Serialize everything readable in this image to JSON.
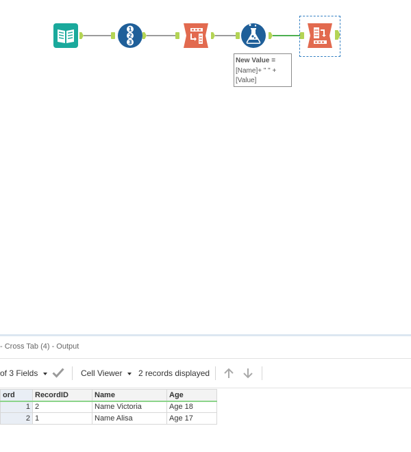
{
  "canvas": {
    "tools": [
      {
        "id": "input-data",
        "icon": "book-icon",
        "color": "#1aa99c"
      },
      {
        "id": "record-id",
        "icon": "numbered-list-icon",
        "color": "#1f5f99"
      },
      {
        "id": "transpose",
        "icon": "transpose-icon",
        "color": "#e26a4f"
      },
      {
        "id": "formula",
        "icon": "flask-icon",
        "color": "#1f5f99"
      },
      {
        "id": "cross-tab",
        "icon": "cross-tab-icon",
        "color": "#e26a4f"
      }
    ],
    "annotation": {
      "bold": "New Value =",
      "line2": "[Name]+ \" \" +",
      "line3": "[Value]"
    }
  },
  "results": {
    "title": "- Cross Tab (4) - Output",
    "fields_label": "of 3 Fields",
    "cell_viewer_label": "Cell Viewer",
    "records_label": "2 records displayed",
    "columns": [
      "ord",
      "RecordID",
      "Name",
      "Age"
    ],
    "rows": [
      [
        "1",
        "2",
        "Name Victoria",
        "Age 18"
      ],
      [
        "2",
        "1",
        "Name Alisa",
        "Age 17"
      ]
    ]
  },
  "colors": {
    "teal_tool": "#1aa99c",
    "blue_tool": "#1f5f99",
    "orange_tool": "#e26a4f",
    "anchor_green": "#b4d455",
    "active_connection": "#4caf50",
    "selection": "#2f7dc1"
  }
}
